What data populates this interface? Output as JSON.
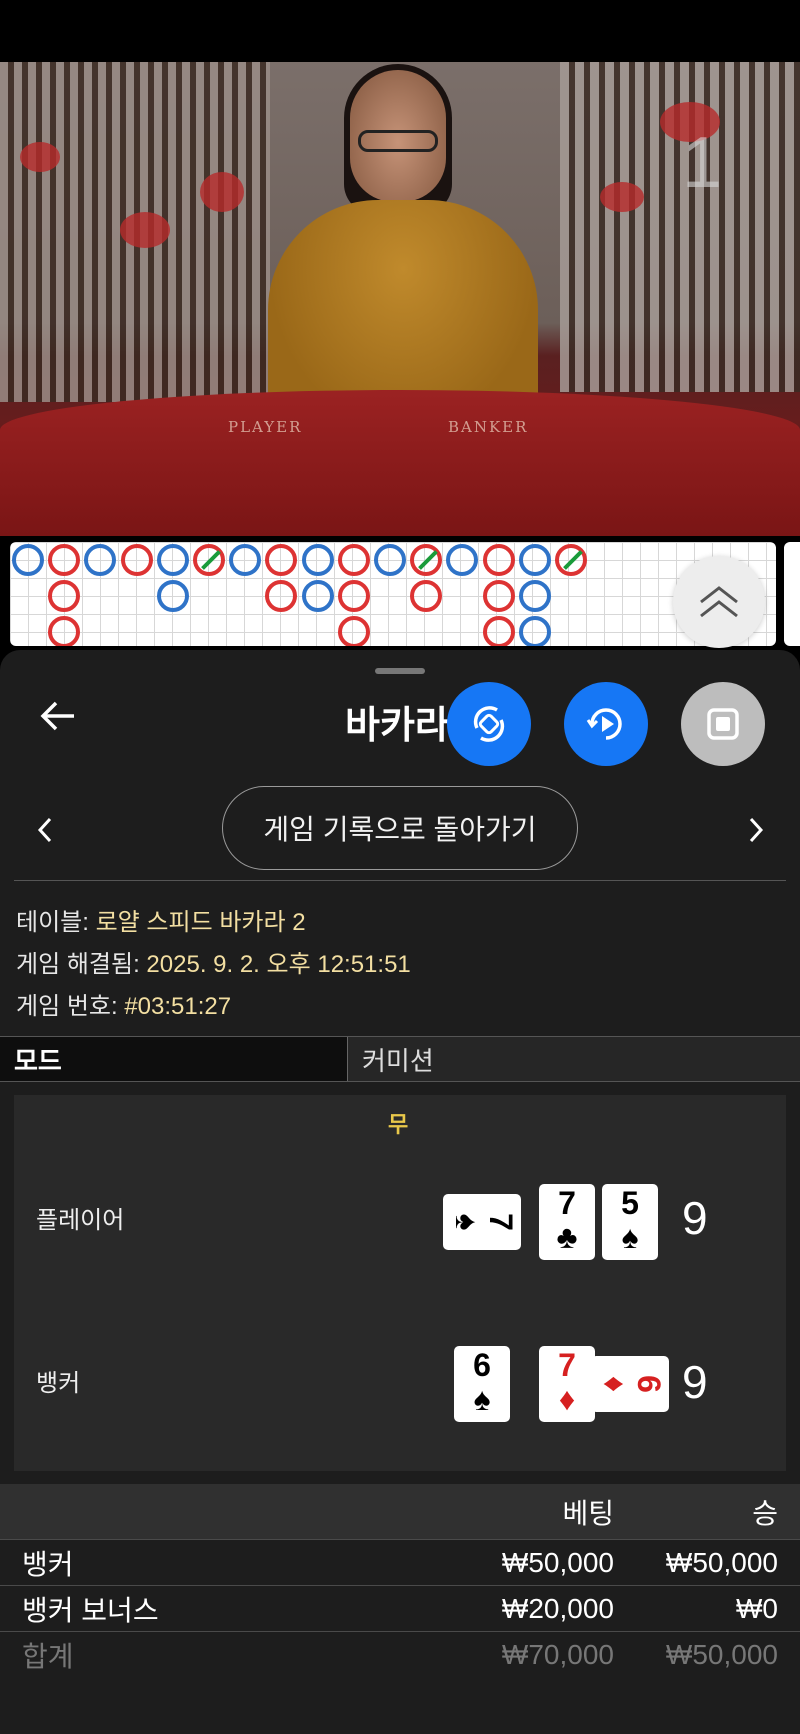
{
  "video": {
    "round_number": "1",
    "felt_player": "PLAYER",
    "felt_banker": "BANKER"
  },
  "roadmap": {
    "beads": [
      [
        "P"
      ],
      [
        "B",
        "B",
        "B"
      ],
      [
        "P"
      ],
      [
        "B"
      ],
      [
        "P",
        "P"
      ],
      [
        "B-tie"
      ],
      [
        "P"
      ],
      [
        "B",
        "B"
      ],
      [
        "P",
        "P"
      ],
      [
        "B",
        "B",
        "B"
      ],
      [
        "P"
      ],
      [
        "B-tie",
        "B"
      ],
      [
        "P"
      ],
      [
        "B",
        "B",
        "B"
      ],
      [
        "P",
        "P",
        "P"
      ],
      [
        "B-tie"
      ]
    ]
  },
  "header": {
    "title": "바카라"
  },
  "nav": {
    "history_button": "게임 기록으로 돌아가기"
  },
  "info": {
    "table_label": "테이블:",
    "table_value": "로얄 스피드 바카라 2",
    "resolved_label": "게임 해결됨:",
    "resolved_value": "2025. 9. 2. 오후 12:51:51",
    "game_number_label": "게임 번호:",
    "game_number_value": "#03:51:27"
  },
  "tabs": {
    "mode": "모드",
    "commission": "커미션"
  },
  "result": {
    "outcome": "무",
    "player_label": "플레이어",
    "player_score": "9",
    "player_cards": [
      {
        "rank": "7",
        "suit": "♠",
        "color": "black",
        "sideways": true
      },
      {
        "rank": "7",
        "suit": "♣",
        "color": "black",
        "sideways": false
      },
      {
        "rank": "5",
        "suit": "♠",
        "color": "black",
        "sideways": false
      }
    ],
    "banker_label": "뱅커",
    "banker_score": "9",
    "banker_cards": [
      {
        "rank": "6",
        "suit": "♠",
        "color": "black",
        "sideways": false
      },
      {
        "rank": "7",
        "suit": "♦",
        "color": "red",
        "sideways": false
      },
      {
        "rank": "6",
        "suit": "♦",
        "color": "red",
        "sideways": true
      }
    ]
  },
  "bets": {
    "head_bet": "베팅",
    "head_win": "승",
    "rows": [
      {
        "name": "뱅커",
        "bet": "₩50,000",
        "win": "₩50,000"
      },
      {
        "name": "뱅커 보너스",
        "bet": "₩20,000",
        "win": "₩0"
      }
    ],
    "total": {
      "name": "합계",
      "bet": "₩70,000",
      "win": "₩50,000"
    }
  },
  "colors": {
    "accent_blue": "#1677f5",
    "banker_red": "#d33333",
    "player_blue": "#2f73c8",
    "tie_green": "#1a9b3a",
    "info_value": "#f3dfa2",
    "outcome_yellow": "#e9c84a"
  }
}
